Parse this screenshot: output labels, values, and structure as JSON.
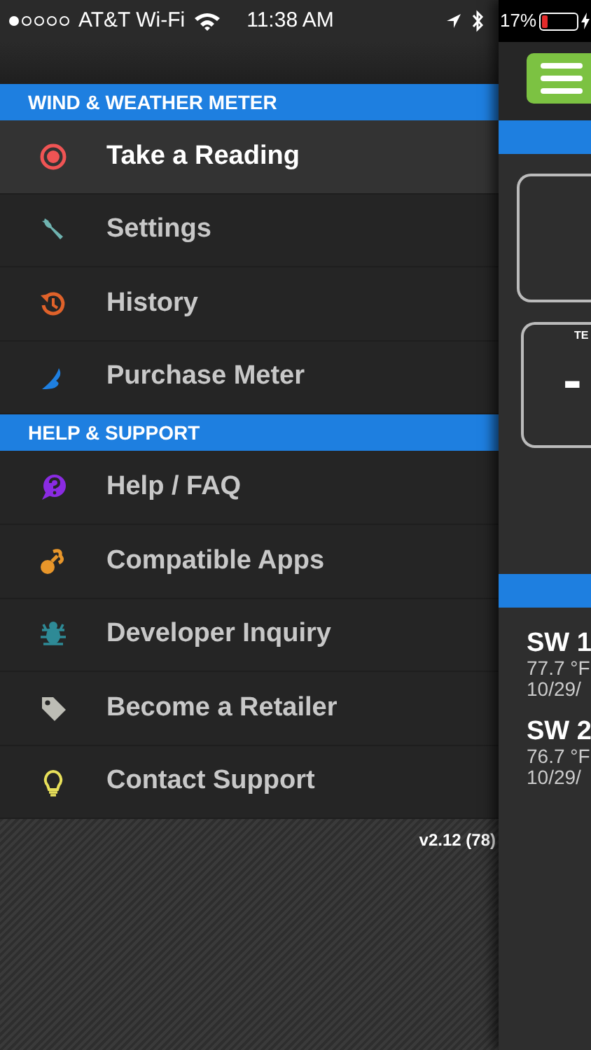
{
  "status_bar": {
    "carrier": "AT&T Wi-Fi",
    "time": "11:38 AM",
    "battery_percent": "17%",
    "battery": {
      "level": 0.17,
      "charging": true
    }
  },
  "menu": {
    "sections": [
      {
        "title": "WIND & WEATHER METER",
        "items": [
          {
            "label": "Take a Reading",
            "kind": "target",
            "color": "#f05454",
            "selected": true
          },
          {
            "label": "Settings",
            "kind": "wrench",
            "color": "#6fb3b0",
            "selected": false
          },
          {
            "label": "History",
            "kind": "history",
            "color": "#e0622a",
            "selected": false
          },
          {
            "label": "Purchase Meter",
            "kind": "bird",
            "color": "#1e7fe0",
            "selected": false
          }
        ]
      },
      {
        "title": "HELP & SUPPORT",
        "items": [
          {
            "label": "Help / FAQ",
            "kind": "question",
            "color": "#8a2be2",
            "selected": false
          },
          {
            "label": "Compatible Apps",
            "kind": "apps",
            "color": "#e8962a",
            "selected": false
          },
          {
            "label": "Developer Inquiry",
            "kind": "bug",
            "color": "#2e8a96",
            "selected": false
          },
          {
            "label": "Become a Retailer",
            "kind": "tag",
            "color": "#bdbdb5",
            "selected": false
          },
          {
            "label": "Contact Support",
            "kind": "bulb",
            "color": "#e8e05a",
            "selected": false
          }
        ]
      }
    ],
    "version": "v2.12 (78)"
  },
  "main": {
    "card_label": "TE",
    "card_value": "-",
    "readings": [
      {
        "name": "SW 1",
        "temperature": "77.7 °F",
        "date": "10/29/"
      },
      {
        "name": "SW 2",
        "temperature": "76.7 °F",
        "date": "10/29/"
      }
    ]
  }
}
